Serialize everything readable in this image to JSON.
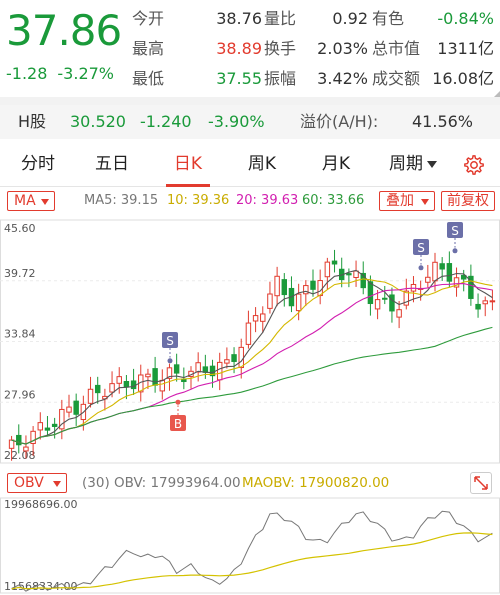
{
  "quote": {
    "price": "37.86",
    "change": "-1.28",
    "change_pct": "-3.27%",
    "rows": [
      {
        "l1": "今开",
        "v1": "38.76",
        "l2": "量比",
        "v2": "0.92",
        "l3": "有色",
        "v3": "-0.84%"
      },
      {
        "l1": "最高",
        "v1": "38.89",
        "l2": "换手",
        "v2": "2.03%",
        "l3": "总市值",
        "v3": "1311亿"
      },
      {
        "l1": "最低",
        "v1": "37.55",
        "l2": "振幅",
        "v2": "3.42%",
        "l3": "成交额",
        "v3": "16.08亿"
      }
    ]
  },
  "hshare": {
    "label": "H股",
    "price": "30.520",
    "change": "-1.240",
    "change_pct": "-3.90%",
    "premium_label": "溢价(A/H):",
    "premium_value": "41.56%"
  },
  "tabs": [
    {
      "label": "分时"
    },
    {
      "label": "五日"
    },
    {
      "label": "日K"
    },
    {
      "label": "周K"
    },
    {
      "label": "月K"
    },
    {
      "label": "周期"
    }
  ],
  "active_tab": 2,
  "indicator": {
    "select": "MA",
    "ma5": "MA5: 39.15",
    "ma10": "10: 39.36",
    "ma20": "20: 39.63",
    "ma60": "60: 33.66",
    "overlay_btn": "叠加",
    "adjust_btn": "前复权"
  },
  "colors": {
    "up": "#e23b2e",
    "down": "#1a9a3a",
    "ma5": "#555555",
    "ma10": "#d4b800",
    "ma20": "#d21fb0",
    "ma60": "#2e9b3c",
    "obv": "#777777",
    "maobv": "#d4c200"
  },
  "kline": {
    "y_labels": [
      "45.60",
      "39.72",
      "33.84",
      "27.96",
      "22.08"
    ],
    "y_range": [
      22.08,
      45.6
    ],
    "markers": [
      {
        "text": "S",
        "kind": "sell"
      },
      {
        "text": "B",
        "kind": "buy"
      },
      {
        "text": "S",
        "kind": "sell"
      },
      {
        "text": "S",
        "kind": "sell"
      }
    ]
  },
  "obv": {
    "select": "OBV",
    "params": "(30) OBV: 17993964.00",
    "maobv": "MAOBV: 17900820.00",
    "top": "19968696.00",
    "bottom": "11568334.00"
  }
}
